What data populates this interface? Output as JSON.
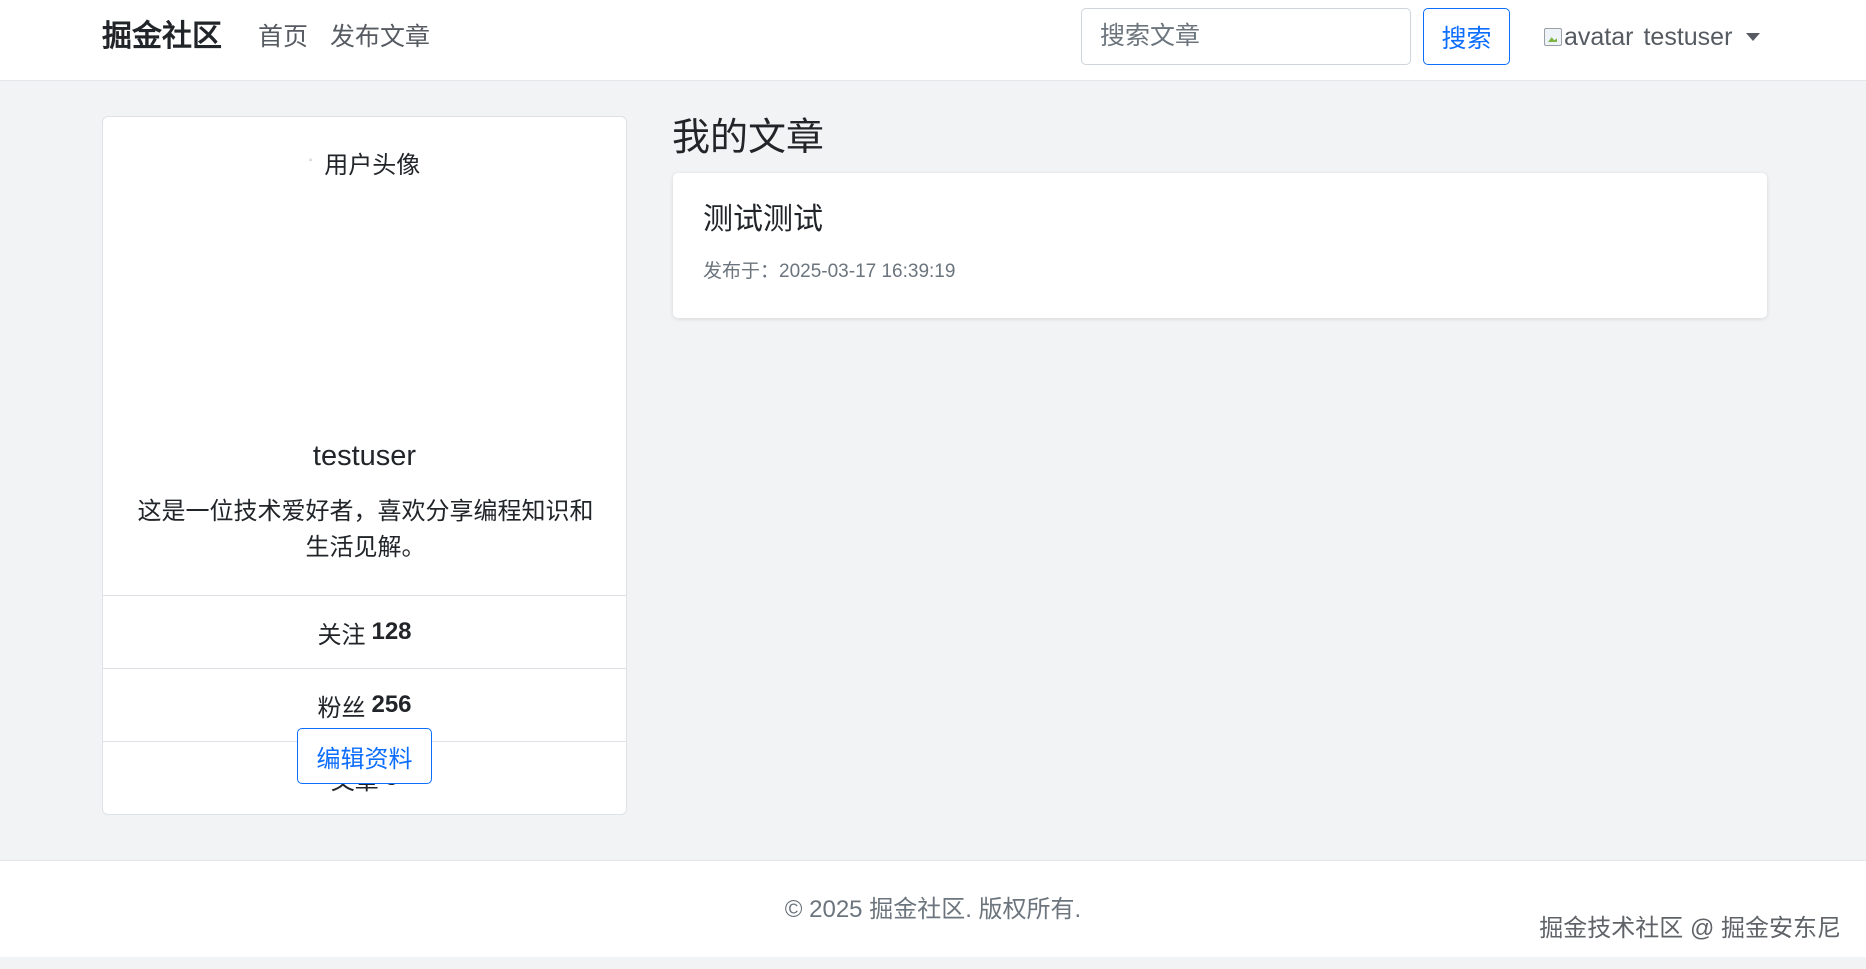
{
  "navbar": {
    "brand": "掘金社区",
    "links": [
      {
        "label": "首页"
      },
      {
        "label": "发布文章"
      }
    ],
    "search": {
      "placeholder": "搜索文章",
      "value": "",
      "button_label": "搜索"
    },
    "user": {
      "avatar_alt": "avatar",
      "username": "testuser"
    }
  },
  "profile": {
    "avatar_alt": "用户头像",
    "name": "testuser",
    "bio": "这是一位技术爱好者，喜欢分享编程知识和生活见解。",
    "stats": [
      {
        "label": "关注",
        "value": "128"
      },
      {
        "label": "粉丝",
        "value": "256"
      },
      {
        "label": "文章",
        "value": "5"
      }
    ],
    "edit_button": "编辑资料"
  },
  "main": {
    "section_title": "我的文章",
    "articles": [
      {
        "title": "测试测试",
        "published_prefix": "发布于：",
        "published_at": "2025-03-17 16:39:19"
      }
    ]
  },
  "footer": {
    "copyright": "© 2025 掘金社区. 版权所有.",
    "watermark": "掘金技术社区 @ 掘金安东尼"
  }
}
